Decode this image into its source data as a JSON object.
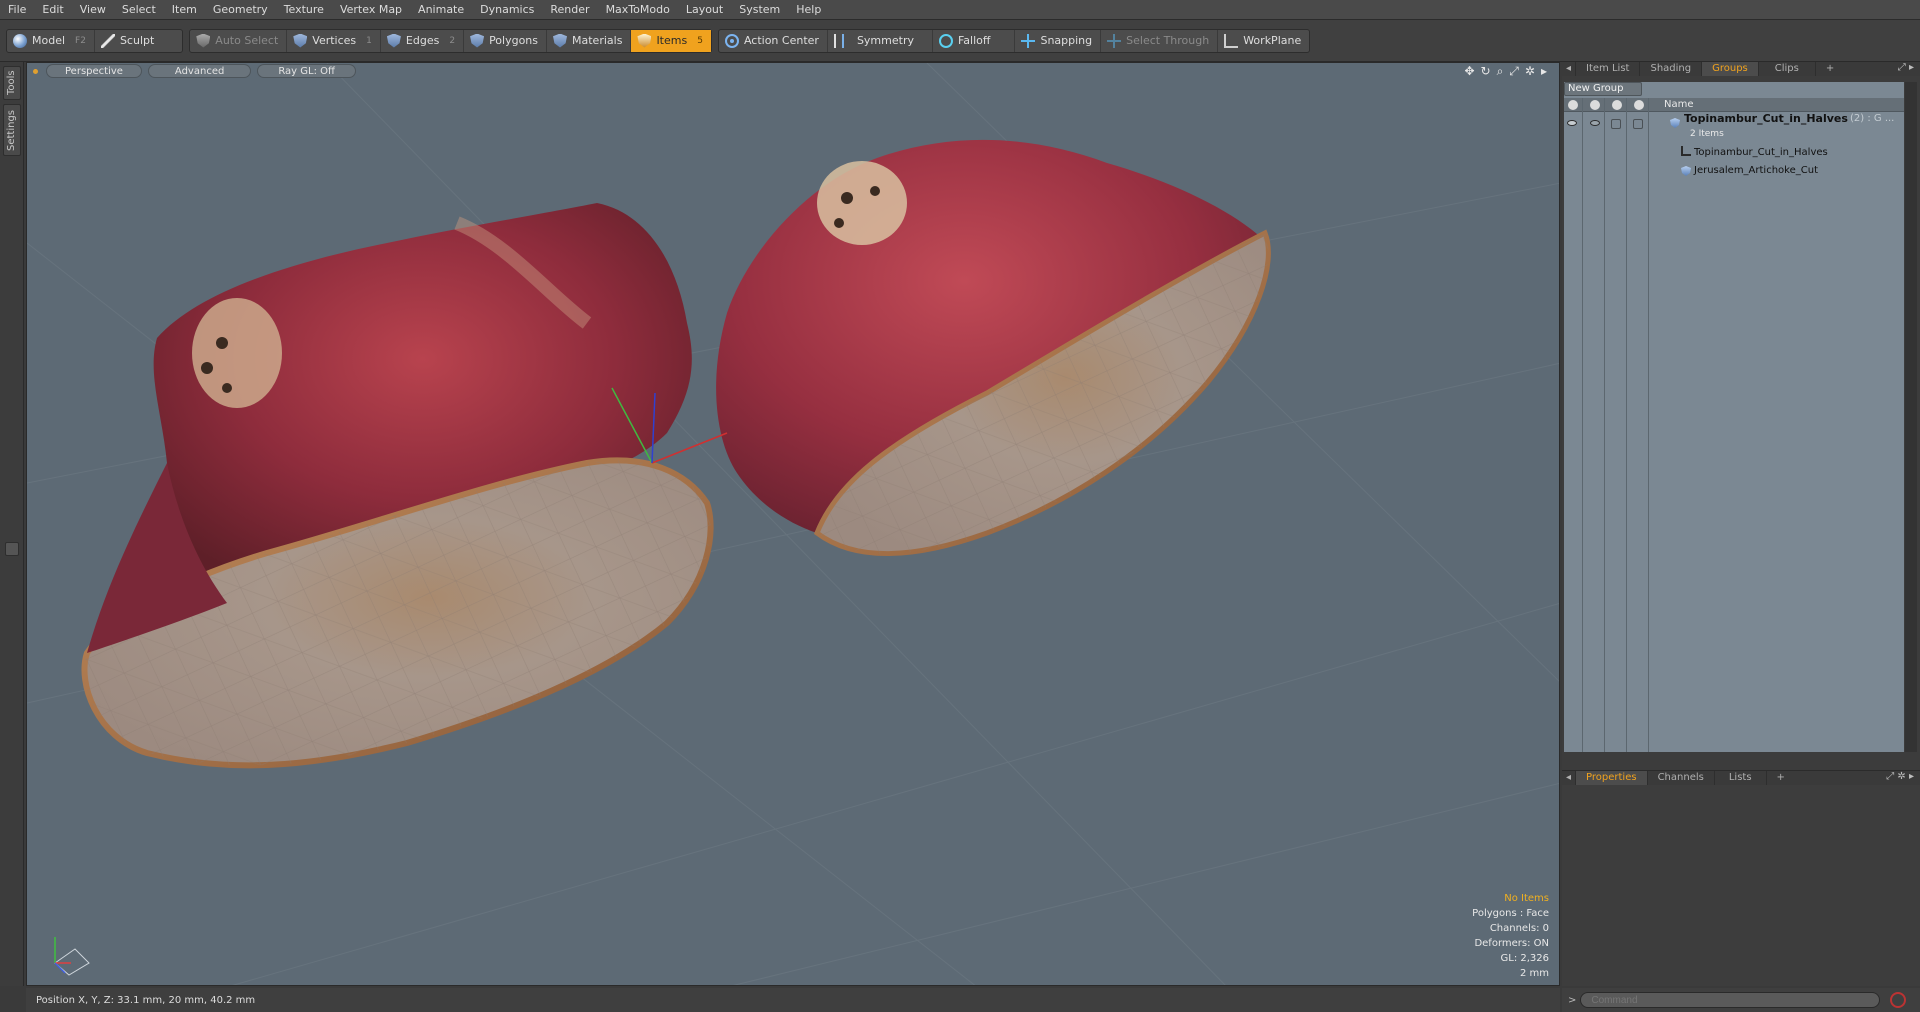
{
  "menu": [
    "File",
    "Edit",
    "View",
    "Select",
    "Item",
    "Geometry",
    "Texture",
    "Vertex Map",
    "Animate",
    "Dynamics",
    "Render",
    "MaxToModo",
    "Layout",
    "System",
    "Help"
  ],
  "toolbar": {
    "model": "Model",
    "model_key": "F2",
    "sculpt": "Sculpt",
    "auto_select": "Auto Select",
    "vertices": "Vertices",
    "vertices_key": "1",
    "edges": "Edges",
    "edges_key": "2",
    "polygons": "Polygons",
    "materials": "Materials",
    "items": "Items",
    "items_key": "5",
    "action_center": "Action Center",
    "symmetry": "Symmetry",
    "falloff": "Falloff",
    "snapping": "Snapping",
    "select_through": "Select Through",
    "workplane": "WorkPlane"
  },
  "left_tabs": [
    "Tools",
    "Settings"
  ],
  "viewport": {
    "view": "Perspective",
    "mode": "Advanced",
    "raygl": "Ray GL: Off",
    "info": {
      "selection": "No Items",
      "polygons": "Polygons : Face",
      "channels": "Channels: 0",
      "deformers": "Deformers: ON",
      "gl": "GL: 2,326",
      "scale": "2 mm"
    },
    "background_color": "#5d6a75"
  },
  "status": {
    "position": "Position X, Y, Z:   33.1 mm, 20 mm, 40.2 mm"
  },
  "command": {
    "placeholder": "Command"
  },
  "groups_panel": {
    "tabs": [
      "Item List",
      "Shading",
      "Groups",
      "Clips",
      "+"
    ],
    "active_tab": "Groups",
    "new_group": "New Group",
    "column_name": "Name",
    "group": {
      "name": "Topinambur_Cut_in_Halves",
      "meta": "(2) : G ...",
      "count": "2 Items"
    },
    "children": [
      "Topinambur_Cut_in_Halves",
      "Jerusalem_Artichoke_Cut"
    ]
  },
  "properties_panel": {
    "tabs": [
      "Properties",
      "Channels",
      "Lists",
      "+"
    ],
    "active_tab": "Properties"
  },
  "colors": {
    "accent": "#f0a21e",
    "panel": "#7b8893"
  }
}
